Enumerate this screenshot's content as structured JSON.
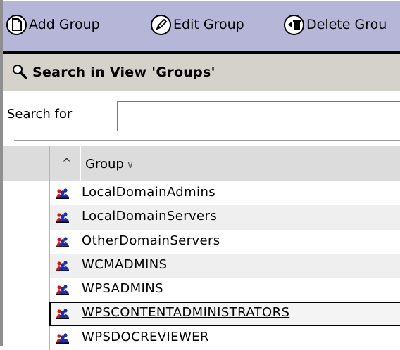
{
  "toolbar": {
    "buttons": [
      {
        "label": "Add Group",
        "icon": "add-document-icon"
      },
      {
        "label": "Edit Group",
        "icon": "edit-pencil-icon"
      },
      {
        "label": "Delete Grou",
        "icon": "delete-bin-icon"
      }
    ]
  },
  "search": {
    "title": "Search in View 'Groups'",
    "label": "Search for",
    "value": ""
  },
  "table": {
    "column_header": "Group",
    "rows": [
      "LocalDomainAdmins",
      "LocalDomainServers",
      "OtherDomainServers",
      "WCMADMINS",
      "WPSADMINS",
      "WPSCONTENTADMINISTRATORS",
      "WPSDOCREVIEWER"
    ],
    "selected_row": "WPSCONTENTADMINISTRATORS"
  },
  "colors": {
    "toolbar_bg": "#b6b6d8",
    "header_bg": "#d4d2ca",
    "column_header_bg": "#dcdcdc",
    "group_icon_blue": "#1a2fa8",
    "group_icon_red": "#c81c1c"
  }
}
